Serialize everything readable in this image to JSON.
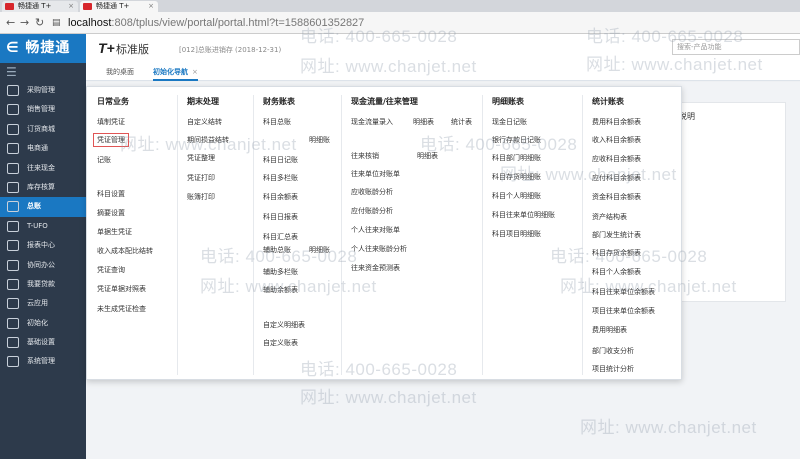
{
  "browser": {
    "tabs": [
      {
        "title": "畅捷通 T+"
      },
      {
        "title": "畅捷通 T+"
      }
    ],
    "url_host": "localhost",
    "url_rest": ":808/tplus/view/portal/portal.html?t=1588601352827"
  },
  "sidebar": {
    "logo": "∈ 畅捷通",
    "menu_toggle": "☰",
    "items": [
      {
        "label": "采购管理",
        "icon": "cart-icon"
      },
      {
        "label": "销售管理",
        "icon": "chart-icon"
      },
      {
        "label": "订货商城",
        "icon": "shop-icon"
      },
      {
        "label": "电商通",
        "icon": "ecommerce-icon"
      },
      {
        "label": "往来现金",
        "icon": "exchange-icon"
      },
      {
        "label": "库存核算",
        "icon": "warehouse-icon"
      },
      {
        "label": "总账",
        "icon": "ledger-icon"
      },
      {
        "label": "T-UFO",
        "icon": "ufo-icon"
      },
      {
        "label": "报表中心",
        "icon": "report-icon"
      },
      {
        "label": "协同办公",
        "icon": "collaboration-icon"
      },
      {
        "label": "我要贷款",
        "icon": "loan-icon"
      },
      {
        "label": "云应用",
        "icon": "cloud-icon"
      },
      {
        "label": "初始化",
        "icon": "init-icon"
      },
      {
        "label": "基础设置",
        "icon": "settings-icon"
      },
      {
        "label": "系统管理",
        "icon": "system-icon"
      }
    ],
    "active_index": 6
  },
  "topbar": {
    "logo": "T+",
    "version": "标准版",
    "account": "[012]总账进销存  (2018-12-31)",
    "search_placeholder": "搜索-产品功能"
  },
  "page_tabs": [
    {
      "label": "我的桌面"
    },
    {
      "label": "初始化导航"
    }
  ],
  "page_tab_close": "×",
  "card": {
    "title": "说明"
  },
  "menu": {
    "columns": [
      {
        "title": "日常业务",
        "items": [
          "填制凭证",
          "凭证管理",
          "记账",
          "科目设置",
          "摘要设置",
          "单据生凭证",
          "收入成本配比结转",
          "凭证查询",
          "凭证单据对照表",
          "未生成凭证检查"
        ],
        "selected": 1
      },
      {
        "title": "期末处理",
        "items": [
          "自定义结转",
          "期间损益结转",
          "凭证整理",
          "凭证打印",
          "账簿打印"
        ]
      },
      {
        "title": "财务账表",
        "items": [
          "科目总账",
          "明细账",
          "科目日记账",
          "科目多栏账",
          "科目余额表",
          "科目日报表",
          "科目汇总表",
          "辅助总账",
          "明细账",
          "辅助多栏账",
          "辅助余额表",
          "自定义明细表",
          "自定义账表"
        ]
      },
      {
        "title": "现金流量/往来管理",
        "items": [
          "现金流量录入",
          "明细表",
          "统计表",
          "往来核销",
          "明细表",
          "往来单位对账单",
          "应收账龄分析",
          "应付账龄分析",
          "个人往来对账单",
          "个人往来账龄分析",
          "往来资金预测表"
        ]
      },
      {
        "title": "明细账表",
        "items": [
          "现金日记账",
          "银行存款日记账",
          "科目部门明细账",
          "科目存货明细账",
          "科目个人明细账",
          "科目往来单位明细账",
          "科目项目明细账"
        ]
      },
      {
        "title": "统计账表",
        "items": [
          "费用科目余额表",
          "收入科目余额表",
          "应收科目余额表",
          "应付科目余额表",
          "资金科目余额表",
          "资产结构表",
          "部门发生统计表",
          "科目存货余额表",
          "科目个人余额表",
          "科目往来单位余额表",
          "项目往来单位余额表",
          "费用明细表",
          "部门收支分析",
          "项目统计分析"
        ]
      }
    ]
  },
  "watermark": {
    "phone": "电话: 400-665-0028",
    "site": "网址: www.chanjet.net"
  }
}
